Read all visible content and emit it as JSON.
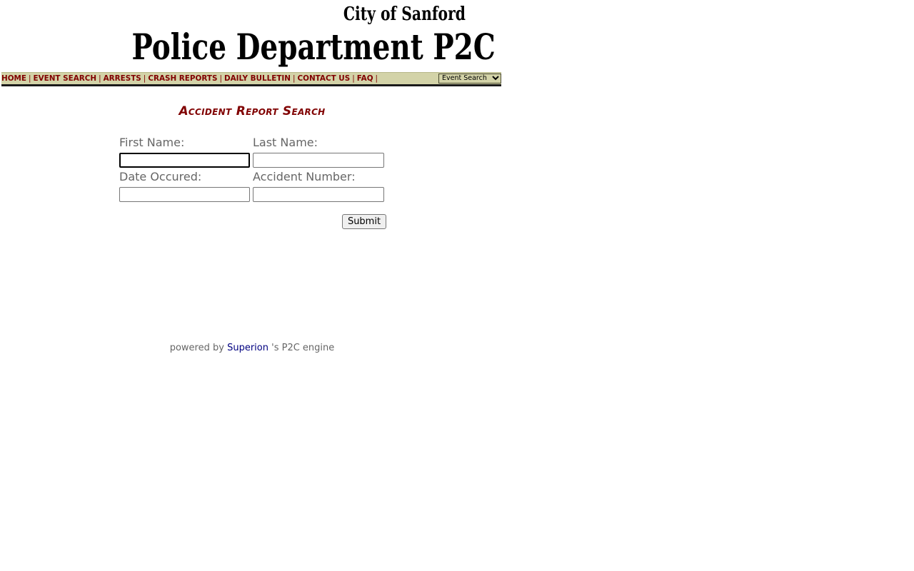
{
  "header": {
    "city_name": "City of Sanford",
    "department_title": "Police Department P2C"
  },
  "nav": {
    "links": [
      {
        "label": "HOME"
      },
      {
        "label": "EVENT SEARCH"
      },
      {
        "label": "ARRESTS"
      },
      {
        "label": "CRASH REPORTS"
      },
      {
        "label": "DAILY BULLETIN"
      },
      {
        "label": "CONTACT US"
      },
      {
        "label": "FAQ"
      }
    ],
    "separator": "|",
    "select_value": "Event Search"
  },
  "form": {
    "title": "Accident Report Search",
    "first_name_label": "First Name:",
    "first_name_value": "",
    "last_name_label": "Last Name:",
    "last_name_value": "",
    "date_label": "Date Occured:",
    "date_value": "",
    "accident_number_label": "Accident Number:",
    "accident_number_value": "",
    "submit_label": "Submit"
  },
  "footer": {
    "prefix": "powered by",
    "vendor": "Superion",
    "suffix": "'s P2C engine"
  },
  "colors": {
    "nav_background": "#d3d3a8",
    "nav_text": "#800000",
    "title_text": "#800000",
    "label_text": "#666666",
    "vendor_link": "#000080"
  }
}
